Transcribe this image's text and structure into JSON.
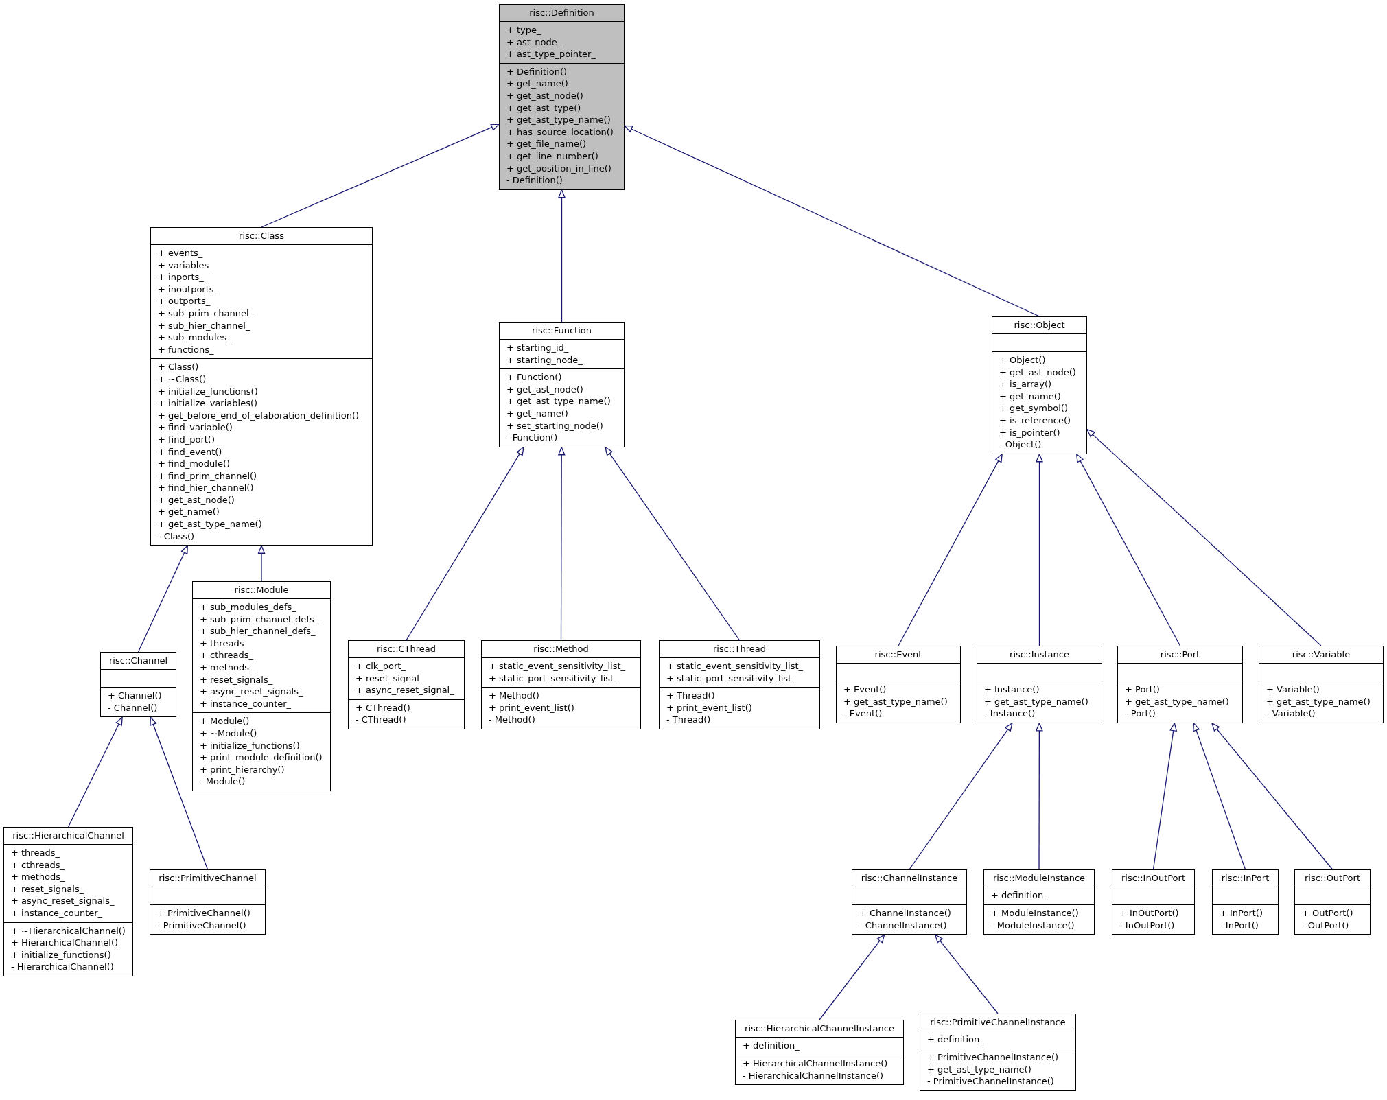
{
  "classes": [
    {
      "name": "risc::Definition",
      "highlighted": true,
      "attributes": [
        "+ type_",
        "+ ast_node_",
        "+ ast_type_pointer_"
      ],
      "methods": [
        "+ Definition()",
        "+ get_name()",
        "+ get_ast_node()",
        "+ get_ast_type()",
        "+ get_ast_type_name()",
        "+ has_source_location()",
        "+ get_file_name()",
        "+ get_line_number()",
        "+ get_position_in_line()",
        "- Definition()"
      ],
      "children": [
        {
          "name": "risc::Class",
          "highlighted": false,
          "attributes": [
            "+ events_",
            "+ variables_",
            "+ inports_",
            "+ inoutports_",
            "+ outports_",
            "+ sub_prim_channel_",
            "+ sub_hier_channel_",
            "+ sub_modules_",
            "+ functions_"
          ],
          "methods": [
            "+ Class()",
            "+ ~Class()",
            "+ initialize_functions()",
            "+ initialize_variables()",
            "+ get_before_end_of_elaboration_definition()",
            "+ find_variable()",
            "+ find_port()",
            "+ find_event()",
            "+ find_module()",
            "+ find_prim_channel()",
            "+ find_hier_channel()",
            "+ get_ast_node()",
            "+ get_name()",
            "+ get_ast_type_name()",
            "- Class()"
          ],
          "children": [
            {
              "name": "risc::Channel",
              "highlighted": false,
              "methods": [
                "+ Channel()",
                "- Channel()"
              ],
              "children": [
                {
                  "name": "risc::HierarchicalChannel",
                  "highlighted": false,
                  "attributes": [
                    "+ threads_",
                    "+ cthreads_",
                    "+ methods_",
                    "+ reset_signals_",
                    "+ async_reset_signals_",
                    "+ instance_counter_"
                  ],
                  "methods": [
                    "+ ~HierarchicalChannel()",
                    "+ HierarchicalChannel()",
                    "+ initialize_functions()",
                    "- HierarchicalChannel()"
                  ]
                },
                {
                  "name": "risc::PrimitiveChannel",
                  "highlighted": false,
                  "methods": [
                    "+ PrimitiveChannel()",
                    "- PrimitiveChannel()"
                  ]
                }
              ]
            },
            {
              "name": "risc::Module",
              "highlighted": false,
              "attributes": [
                "+ sub_modules_defs_",
                "+ sub_prim_channel_defs_",
                "+ sub_hier_channel_defs_",
                "+ threads_",
                "+ cthreads_",
                "+ methods_",
                "+ reset_signals_",
                "+ async_reset_signals_",
                "+ instance_counter_"
              ],
              "methods": [
                "+ Module()",
                "+ ~Module()",
                "+ initialize_functions()",
                "+ print_module_definition()",
                "+ print_hierarchy()",
                "- Module()"
              ]
            }
          ]
        },
        {
          "name": "risc::Function",
          "highlighted": false,
          "attributes": [
            "+ starting_id_",
            "+ starting_node_"
          ],
          "methods": [
            "+ Function()",
            "+ get_ast_node()",
            "+ get_ast_type_name()",
            "+ get_name()",
            "+ set_starting_node()",
            "- Function()"
          ],
          "children": [
            {
              "name": "risc::CThread",
              "highlighted": false,
              "attributes": [
                "+ clk_port_",
                "+ reset_signal_",
                "+ async_reset_signal_"
              ],
              "methods": [
                "+ CThread()",
                "- CThread()"
              ]
            },
            {
              "name": "risc::Method",
              "highlighted": false,
              "attributes": [
                "+ static_event_sensitivity_list_",
                "+ static_port_sensitivity_list_"
              ],
              "methods": [
                "+ Method()",
                "+ print_event_list()",
                "- Method()"
              ]
            },
            {
              "name": "risc::Thread",
              "highlighted": false,
              "attributes": [
                "+ static_event_sensitivity_list_",
                "+ static_port_sensitivity_list_"
              ],
              "methods": [
                "+ Thread()",
                "+ print_event_list()",
                "- Thread()"
              ]
            }
          ]
        },
        {
          "name": "risc::Object",
          "highlighted": false,
          "methods": [
            "+ Object()",
            "+ get_ast_node()",
            "+ is_array()",
            "+ get_name()",
            "+ get_symbol()",
            "+ is_reference()",
            "+ is_pointer()",
            "- Object()"
          ],
          "children": [
            {
              "name": "risc::Event",
              "highlighted": false,
              "methods": [
                "+ Event()",
                "+ get_ast_type_name()",
                "- Event()"
              ]
            },
            {
              "name": "risc::Instance",
              "highlighted": false,
              "methods": [
                "+ Instance()",
                "+ get_ast_type_name()",
                "- Instance()"
              ],
              "children": [
                {
                  "name": "risc::ChannelInstance",
                  "highlighted": false,
                  "methods": [
                    "+ ChannelInstance()",
                    "- ChannelInstance()"
                  ],
                  "children": [
                    {
                      "name": "risc::HierarchicalChannelInstance",
                      "highlighted": false,
                      "attributes": [
                        "+ definition_"
                      ],
                      "methods": [
                        "+ HierarchicalChannelInstance()",
                        "- HierarchicalChannelInstance()"
                      ]
                    },
                    {
                      "name": "risc::PrimitiveChannelInstance",
                      "highlighted": false,
                      "attributes": [
                        "+ definition_"
                      ],
                      "methods": [
                        "+ PrimitiveChannelInstance()",
                        "+ get_ast_type_name()",
                        "- PrimitiveChannelInstance()"
                      ]
                    }
                  ]
                },
                {
                  "name": "risc::ModuleInstance",
                  "highlighted": false,
                  "attributes": [
                    "+ definition_"
                  ],
                  "methods": [
                    "+ ModuleInstance()",
                    "- ModuleInstance()"
                  ]
                }
              ]
            },
            {
              "name": "risc::Port",
              "highlighted": false,
              "methods": [
                "+ Port()",
                "+ get_ast_type_name()",
                "- Port()"
              ],
              "children": [
                {
                  "name": "risc::InOutPort",
                  "highlighted": false,
                  "methods": [
                    "+ InOutPort()",
                    "- InOutPort()"
                  ]
                },
                {
                  "name": "risc::InPort",
                  "highlighted": false,
                  "methods": [
                    "+ InPort()",
                    "- InPort()"
                  ]
                },
                {
                  "name": "risc::OutPort",
                  "highlighted": false,
                  "methods": [
                    "+ OutPort()",
                    "- OutPort()"
                  ]
                }
              ]
            },
            {
              "name": "risc::Variable",
              "highlighted": false,
              "methods": [
                "+ Variable()",
                "+ get_ast_type_name()",
                "- Variable()"
              ]
            }
          ]
        }
      ]
    }
  ]
}
